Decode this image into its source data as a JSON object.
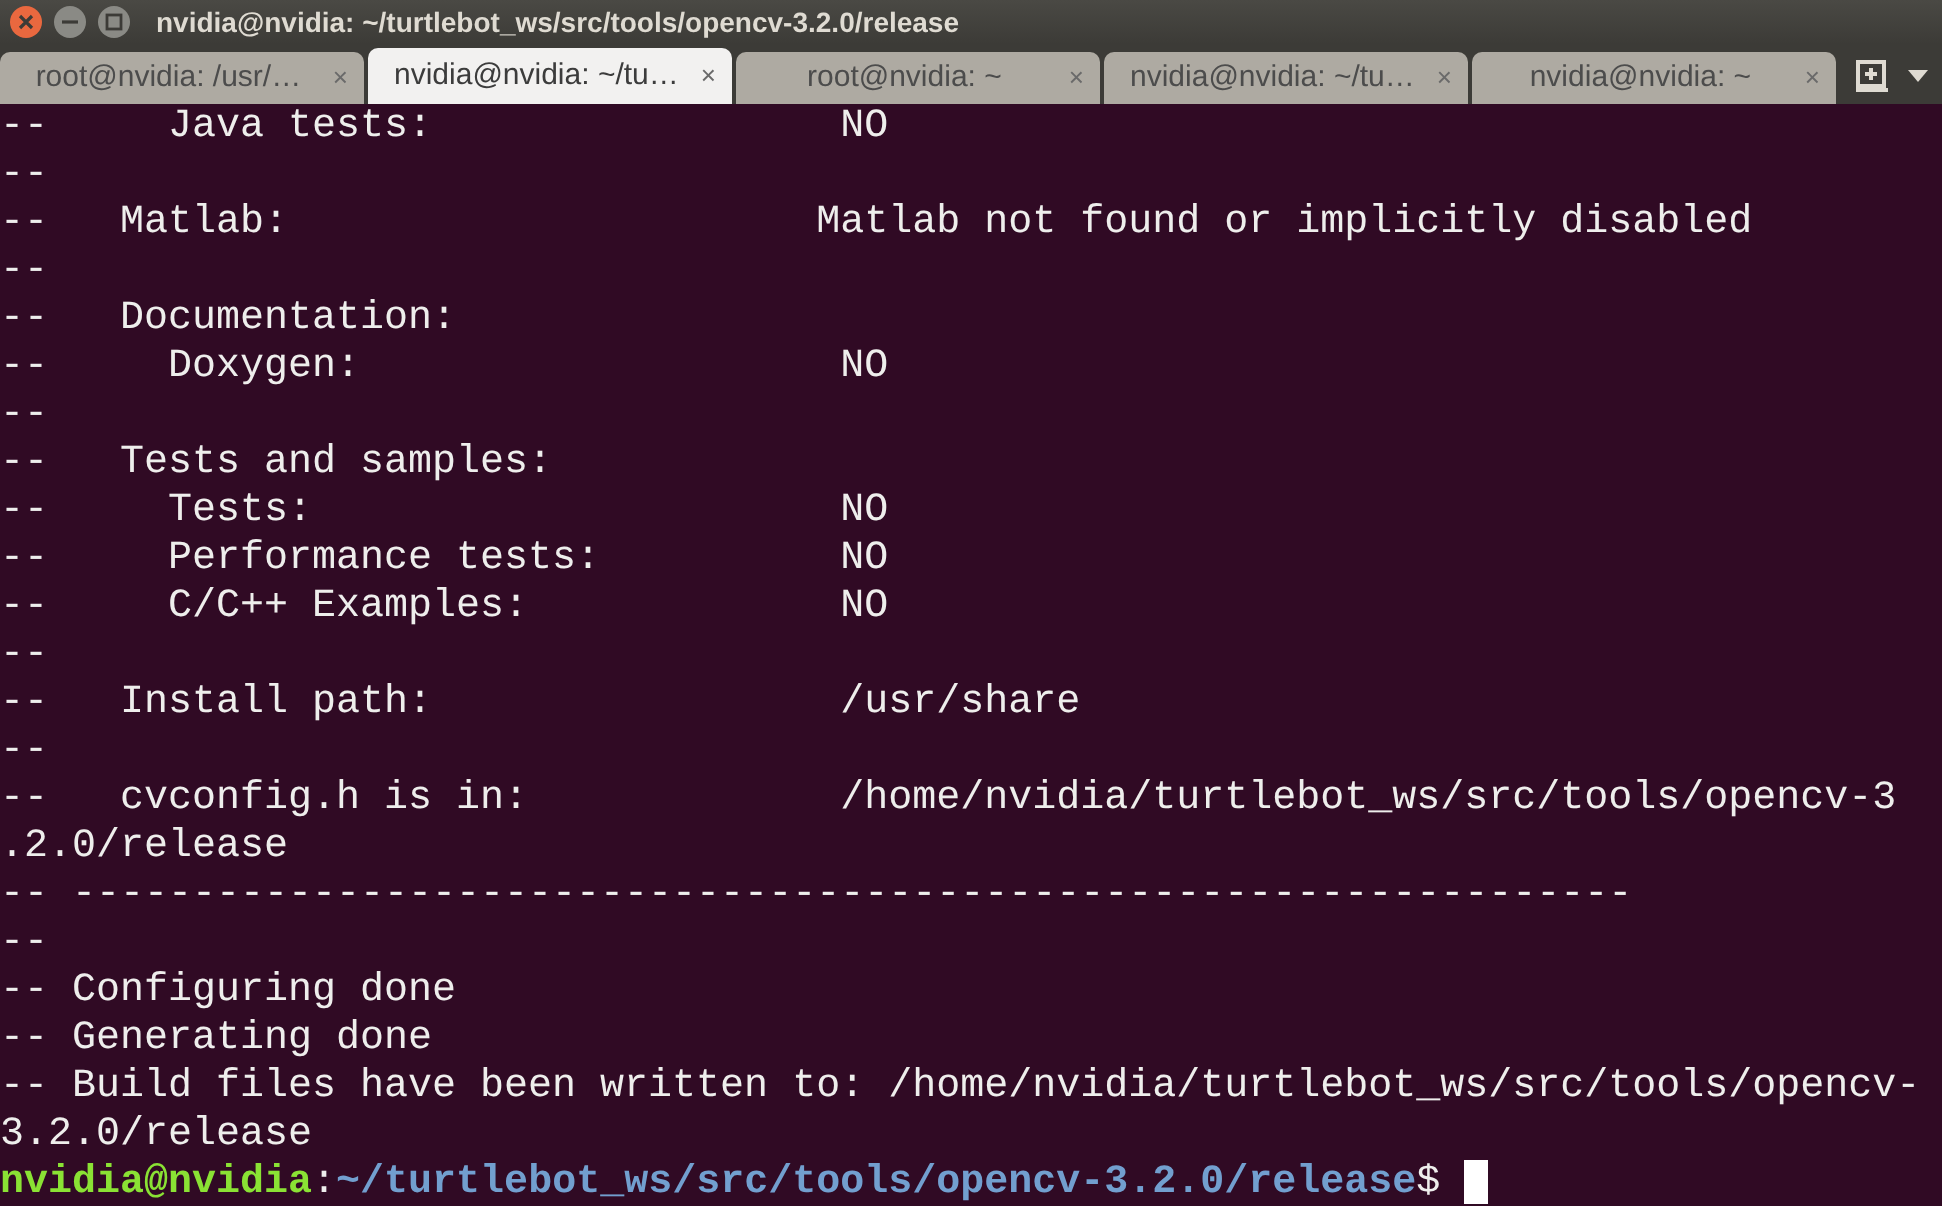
{
  "window": {
    "title": "nvidia@nvidia: ~/turtlebot_ws/src/tools/opencv-3.2.0/release"
  },
  "tabs": [
    {
      "label": "root@nvidia: /usr/…",
      "selected": false,
      "close": "×"
    },
    {
      "label": "nvidia@nvidia: ~/tu…",
      "selected": true,
      "close": "×"
    },
    {
      "label": "root@nvidia: ~",
      "selected": false,
      "close": "×"
    },
    {
      "label": "nvidia@nvidia: ~/tu…",
      "selected": false,
      "close": "×"
    },
    {
      "label": "nvidia@nvidia: ~",
      "selected": false,
      "close": "×"
    }
  ],
  "lines": [
    "--     Java tests:                 NO",
    "--",
    "--   Matlab:                      Matlab not found or implicitly disabled",
    "--",
    "--   Documentation:",
    "--     Doxygen:                    NO",
    "--",
    "--   Tests and samples:",
    "--     Tests:                      NO",
    "--     Performance tests:          NO",
    "--     C/C++ Examples:             NO",
    "--",
    "--   Install path:                 /usr/share",
    "--",
    "--   cvconfig.h is in:             /home/nvidia/turtlebot_ws/src/tools/opencv-3",
    ".2.0/release",
    "-- -----------------------------------------------------------------",
    "--",
    "-- Configuring done",
    "-- Generating done",
    "-- Build files have been written to: /home/nvidia/turtlebot_ws/src/tools/opencv-",
    "3.2.0/release"
  ],
  "prompt": {
    "user_host": "nvidia@nvidia",
    "separator": ":",
    "path": "~/turtlebot_ws/src/tools/opencv-3.2.0/release",
    "symbol": "$"
  }
}
